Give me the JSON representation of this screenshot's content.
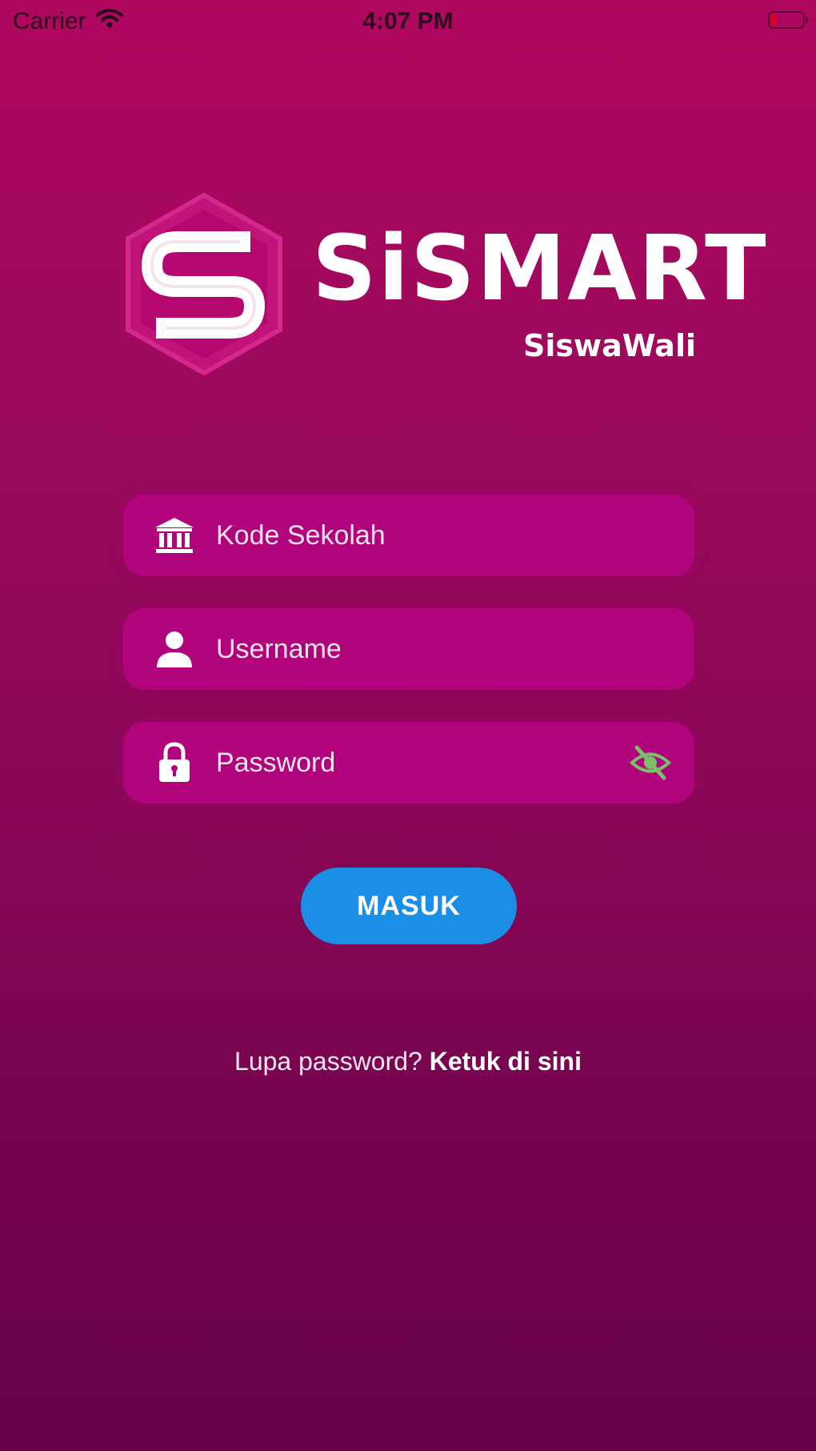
{
  "status_bar": {
    "carrier": "Carrier",
    "time": "4:07 PM",
    "wifi_icon": "wifi-icon",
    "battery_icon": "battery-icon"
  },
  "logo": {
    "title": "SiSMART",
    "subtitle": "SiswaWali",
    "mark_icon": "sismart-logo-mark"
  },
  "form": {
    "school_code": {
      "placeholder": "Kode Sekolah",
      "value": "",
      "icon": "bank-icon"
    },
    "username": {
      "placeholder": "Username",
      "value": "",
      "icon": "user-icon"
    },
    "password": {
      "placeholder": "Password",
      "value": "",
      "icon": "lock-icon",
      "toggle_icon": "eye-slash-icon"
    },
    "submit_label": "MASUK"
  },
  "forgot": {
    "prompt": "Lupa password?",
    "link": "Ketuk di sini"
  },
  "colors": {
    "background_top": "#b0075f",
    "background_bottom": "#66034a",
    "field": "#b1047c",
    "button": "#1b8fe6",
    "eye_icon": "#7bbf6a"
  }
}
